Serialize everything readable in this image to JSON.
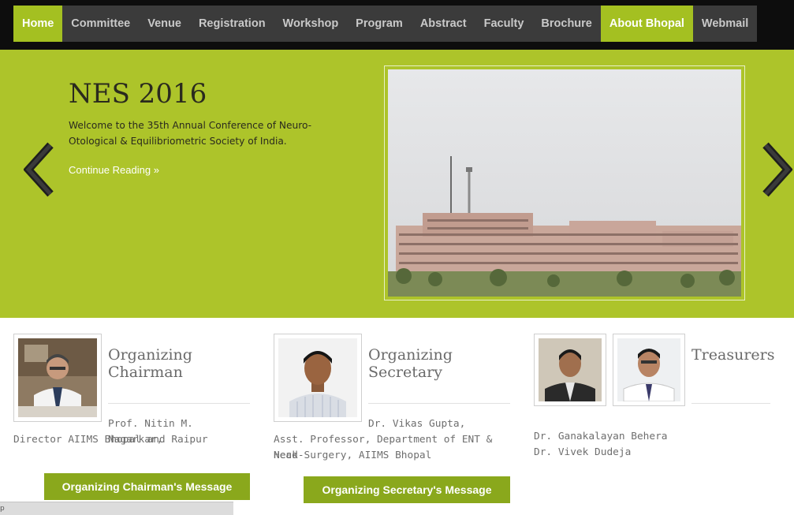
{
  "nav": {
    "items": [
      "Home",
      "Committee",
      "Venue",
      "Registration",
      "Workshop",
      "Program",
      "Abstract",
      "Faculty",
      "Brochure",
      "About Bhopal",
      "Webmail"
    ],
    "active": [
      "Home",
      "About Bhopal"
    ]
  },
  "hero": {
    "title": "NES 2016",
    "text": "Welcome to the 35th Annual Conference of Neuro-Otological & Equilibriometric Society of India.",
    "link": "Continue Reading »"
  },
  "chairman": {
    "title_line1": "Organizing",
    "title_line2": "Chairman",
    "name": "Prof. Nitin M. Nagarkar,",
    "role": "Director AIIMS Bhopal and Raipur",
    "button": "Organizing Chairman's Message"
  },
  "secretary": {
    "title_line1": "Organizing",
    "title_line2": "Secretary",
    "name": "Dr. Vikas Gupta,",
    "role_line1": "Asst. Professor, Department of ENT & Head-",
    "role_line2": "Neck Surgery, AIIMS Bhopal",
    "button": "Organizing Secretary's Message"
  },
  "treasurers": {
    "title": "Treasurers",
    "names": [
      "Dr. Ganakalayan Behera",
      "Dr. Vivek Dudeja"
    ]
  },
  "bottom_tab": "p",
  "colors": {
    "accent": "#adc42a",
    "nav_active": "#a4c021",
    "button": "#8aa81c",
    "nav_bg": "#3b3b3b"
  }
}
